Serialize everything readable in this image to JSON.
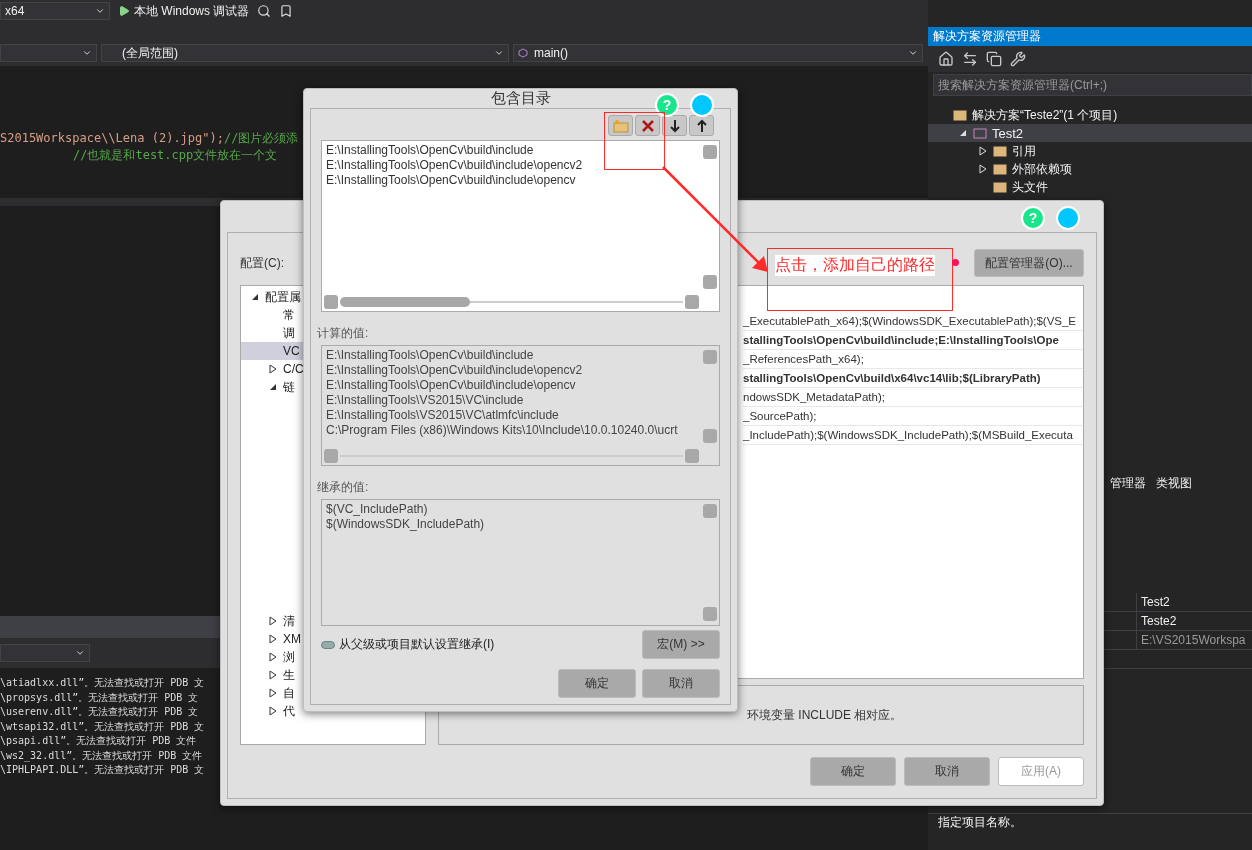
{
  "toolbar": {
    "platform": "x64",
    "debugger": "本地 Windows 调试器"
  },
  "navigation_bar": {
    "scope": "(全局范围)",
    "member": "main()"
  },
  "editor": {
    "lines": [
      {
        "kind": "code",
        "code": "S2015Workspace\\\\Lena (2).jpg\");",
        "comment": "//图片必须添"
      },
      {
        "kind": "comment",
        "comment": "//也就是和test.cpp文件放在一个文"
      }
    ]
  },
  "output": {
    "lines": [
      "\\atiadlxx.dll”。无法查找或打开 PDB 文",
      "\\propsys.dll”。无法查找或打开 PDB 文",
      "\\userenv.dll”。无法查找或打开 PDB 文",
      "\\wtsapi32.dll”。无法查找或打开 PDB 文",
      "\\psapi.dll”。无法查找或打开 PDB 文件",
      "\\ws2_32.dll”。无法查找或打开 PDB 文件",
      "\\IPHLPAPI.DLL”。无法查找或打开 PDB 文"
    ]
  },
  "solution_explorer": {
    "title": "解决方案资源管理器",
    "search": {
      "placeholder": "搜索解决方案资源管理器(Ctrl+;)"
    },
    "tree": [
      {
        "label": "解决方案“Teste2”(1 个项目)",
        "selected": false,
        "children": [
          {
            "label": "Test2",
            "expanded": true,
            "selected": true,
            "children": [
              {
                "label": "引用",
                "expanded": false,
                "selected": false
              },
              {
                "label": "外部依赖项",
                "expanded": false,
                "selected": false
              },
              {
                "label": "头文件",
                "selected": false
              }
            ]
          }
        ]
      }
    ]
  },
  "bottom_tabs": [
    {
      "label": "管理器",
      "selected": false
    },
    {
      "label": "类视图",
      "selected": false
    }
  ],
  "properties": {
    "rows": [
      {
        "value": "Test2",
        "disabled": false
      },
      {
        "value": "Teste2",
        "disabled": false
      },
      {
        "value": "E:\\VS2015Workspa",
        "disabled": true
      }
    ],
    "description": "指定项目名称。"
  },
  "property_pages": {
    "help": "?",
    "config_label": "配置(C):",
    "tree": [
      {
        "label": "配置属",
        "expanded": true,
        "selected": false,
        "children": [
          {
            "label": "常",
            "selected": false
          },
          {
            "label": "调",
            "selected": false
          },
          {
            "label": "VC",
            "selected": true
          },
          {
            "label": "C/C",
            "expanded": false,
            "selected": false
          },
          {
            "label": "链",
            "expanded": true,
            "selected": false
          },
          {
            "label": "清",
            "expanded": false,
            "selected": false
          },
          {
            "label": "XM",
            "expanded": false,
            "selected": false
          },
          {
            "label": "浏",
            "expanded": false,
            "selected": false
          },
          {
            "label": "生",
            "expanded": false,
            "selected": false
          },
          {
            "label": "自",
            "expanded": false,
            "selected": false
          },
          {
            "label": "代",
            "expanded": false,
            "selected": false
          }
        ]
      }
    ],
    "config_manager_button": "配置管理器(O)...",
    "grid_rows": [
      {
        "value": "_ExecutablePath_x64);$(WindowsSDK_ExecutablePath);$(VS_E",
        "bold": false
      },
      {
        "value": "stallingTools\\OpenCv\\build\\include;E:\\InstallingTools\\Ope",
        "bold": true
      },
      {
        "value": "_ReferencesPath_x64);",
        "bold": false
      },
      {
        "value": "stallingTools\\OpenCv\\build\\x64\\vc14\\lib;$(LibraryPath)",
        "bold": true
      },
      {
        "value": "ndowsSDK_MetadataPath);",
        "bold": false
      },
      {
        "value": "_SourcePath);",
        "bold": false
      },
      {
        "value": "_IncludePath);$(WindowsSDK_IncludePath);$(MSBuild_Executa",
        "bold": false
      }
    ],
    "description": "环境变量 INCLUDE 相对应。",
    "buttons": [
      {
        "label": "确定",
        "disabled": false
      },
      {
        "label": "取消",
        "disabled": false
      },
      {
        "label": "应用(A)",
        "disabled": true
      }
    ]
  },
  "include_dialog": {
    "title": "包含目录",
    "help": "?",
    "entries": [
      "E:\\InstallingTools\\OpenCv\\build\\include",
      "E:\\InstallingTools\\OpenCv\\build\\include\\opencv2",
      "E:\\InstallingTools\\OpenCv\\build\\include\\opencv"
    ],
    "computed_label": "计算的值:",
    "computed": [
      "E:\\InstallingTools\\OpenCv\\build\\include",
      "E:\\InstallingTools\\OpenCv\\build\\include\\opencv2",
      "E:\\InstallingTools\\OpenCv\\build\\include\\opencv",
      "E:\\InstallingTools\\VS2015\\VC\\include",
      "E:\\InstallingTools\\VS2015\\VC\\atlmfc\\include",
      "C:\\Program Files (x86)\\Windows Kits\\10\\Include\\10.0.10240.0\\ucrt"
    ],
    "inherited_label": "继承的值:",
    "inherited": [
      "$(VC_IncludePath)",
      "$(WindowsSDK_IncludePath)"
    ],
    "inherit_option": "从父级或项目默认设置继承(I)",
    "macros_button": "宏(M) >>",
    "buttons": [
      "确定",
      "取消"
    ]
  },
  "annotation": {
    "callout": "点击，添加自己的路径"
  }
}
